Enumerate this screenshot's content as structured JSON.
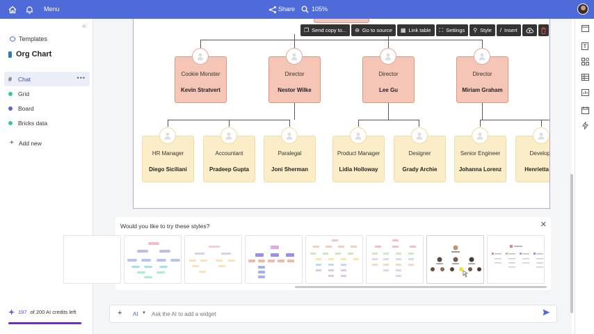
{
  "topbar": {
    "menu_label": "Menu",
    "share_label": "Share",
    "zoom_label": "105%",
    "icons": [
      "home-icon",
      "bell-icon",
      "share-icon",
      "zoom-icon"
    ]
  },
  "sidebar": {
    "templates_label": "Templates",
    "doc_title": "Org Chart",
    "items": [
      {
        "label": "Chat",
        "color": "#444444",
        "active": true
      },
      {
        "label": "Grid",
        "color": "#3cc49a"
      },
      {
        "label": "Board",
        "color": "#5a63c8"
      },
      {
        "label": "Bricks data",
        "color": "#3cc49a"
      }
    ],
    "more_label": "•••",
    "add_new_label": "Add new",
    "credits": {
      "used": "197",
      "text": "of 200 AI credits left",
      "fraction": 0.985
    }
  },
  "toolbar": {
    "send_copy": "Send copy to...",
    "go_to_source": "Go to source",
    "link_table": "Link table",
    "settings": "Settings",
    "style": "Style",
    "insert": "Insert"
  },
  "org": {
    "managers": [
      {
        "role": "Cookie Monster",
        "name": "Kevin Stratvert"
      },
      {
        "role": "Director",
        "name": "Nestor Wilke"
      },
      {
        "role": "Director",
        "name": "Lee Gu"
      },
      {
        "role": "Director",
        "name": "Miriam Graham"
      }
    ],
    "reports": [
      {
        "role": "HR Manager",
        "name": "Diego Siciliani"
      },
      {
        "role": "Accountant",
        "name": "Pradeep Gupta"
      },
      {
        "role": "Paralegal",
        "name": "Joni Sherman"
      },
      {
        "role": "Product Manager",
        "name": "Lidia Holloway"
      },
      {
        "role": "Designer",
        "name": "Grady Archie"
      },
      {
        "role": "Senior Engineer",
        "name": "Johanna Lorenz"
      },
      {
        "role": "Develope",
        "name": "Henrietta Mu"
      }
    ]
  },
  "styles_panel": {
    "title": "Would you like to try these styles?",
    "close_label": "✕"
  },
  "chat": {
    "plus_label": "+",
    "ai_label": "AI",
    "placeholder": "Ask the AI to add a widget"
  },
  "colors": {
    "accent": "#4e6bd9",
    "manager_card": "#f5c5b6",
    "report_card": "#fbedc7",
    "credits": "#6a2fd6"
  }
}
